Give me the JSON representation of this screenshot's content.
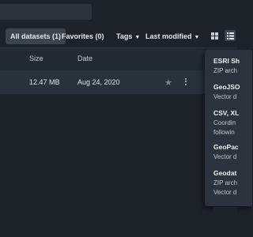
{
  "filters": {
    "all_datasets": "All datasets (1)",
    "favorites": "Favorites (0)",
    "tags": "Tags",
    "last_modified": "Last modified"
  },
  "icons": {
    "grid_view": "grid-view-icon",
    "list_view": "list-view-icon",
    "star": "star-icon",
    "more": "more-vertical-icon",
    "caret": "caret-down-icon"
  },
  "table": {
    "columns": [
      "Size",
      "Date"
    ],
    "rows": [
      {
        "size": "12.47 MB",
        "date": "Aug 24, 2020"
      }
    ]
  },
  "export_menu": {
    "options": [
      {
        "title": "ESRI Sh",
        "desc": "ZIP arch"
      },
      {
        "title": "GeoJSO",
        "desc": "Vector d"
      },
      {
        "title": "CSV, XL",
        "desc": "Coordin",
        "desc2": "followin"
      },
      {
        "title": "GeoPac",
        "desc": "Vector d"
      },
      {
        "title": "Geodat",
        "desc": "ZIP arch",
        "desc2": "Vector d"
      }
    ]
  },
  "colors": {
    "background": "#1c232b",
    "active_pill": "#3a444e",
    "selected_row": "#28323c",
    "menu": "#2b343e"
  }
}
